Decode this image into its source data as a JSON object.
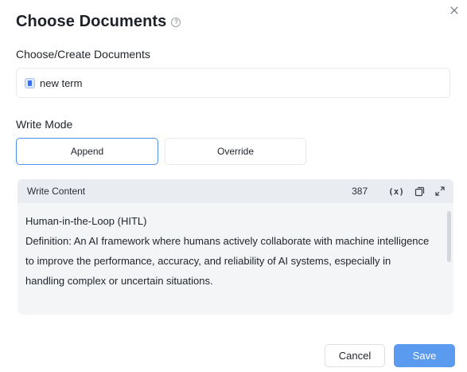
{
  "dialog": {
    "title": "Choose Documents",
    "help_icon": "question-circle-icon",
    "close_icon": "close-icon"
  },
  "documents": {
    "label": "Choose/Create Documents",
    "selected": "new term",
    "doc_icon": "document-icon"
  },
  "write_mode": {
    "label": "Write Mode",
    "options": [
      "Append",
      "Override"
    ],
    "selected": "Append"
  },
  "write_content": {
    "label": "Write Content",
    "char_count": "387",
    "variable_icon_label": "(x)",
    "icons": [
      "variable-icon",
      "copy-icon",
      "expand-icon"
    ],
    "lines": [
      "Human-in-the-Loop (HITL)",
      "Definition: An AI framework where humans actively collaborate with machine intelligence to improve the performance, accuracy, and reliability of AI systems, especially in handling complex or uncertain situations."
    ]
  },
  "footer": {
    "cancel_label": "Cancel",
    "save_label": "Save"
  },
  "colors": {
    "primary": "#5a9bf0",
    "selected_border": "#4f8ee8",
    "panel_bg": "#f3f5f7"
  }
}
